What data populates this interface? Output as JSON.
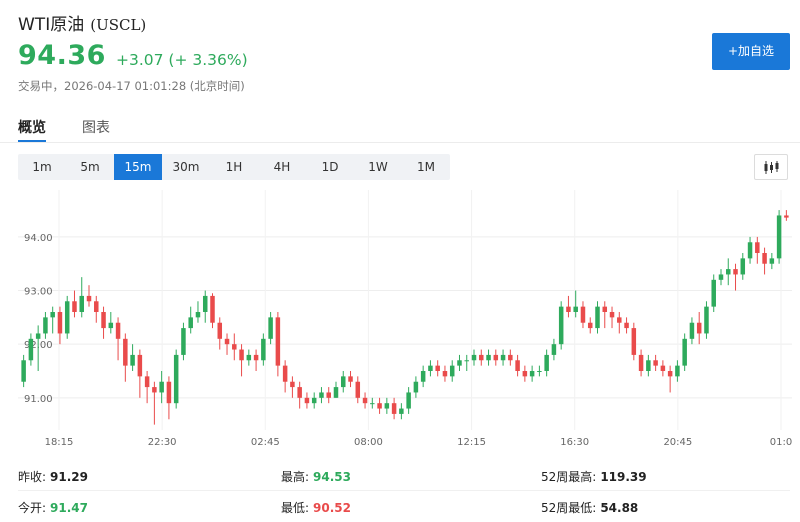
{
  "header": {
    "name": "WTI原油",
    "code": "(USCL)",
    "price": "94.36",
    "change": "+3.07 (+ 3.36%)",
    "status": "交易中，2026-04-17 01:01:28 (北京时间)",
    "add_button": "+加自选"
  },
  "tabs": [
    {
      "label": "概览",
      "active": true
    },
    {
      "label": "图表",
      "active": false
    }
  ],
  "intervals": [
    {
      "label": "1m"
    },
    {
      "label": "5m"
    },
    {
      "label": "15m",
      "active": true
    },
    {
      "label": "30m"
    },
    {
      "label": "1H"
    },
    {
      "label": "4H"
    },
    {
      "label": "1D"
    },
    {
      "label": "1W"
    },
    {
      "label": "1M"
    }
  ],
  "colors": {
    "up": "#2eaa5c",
    "down": "#e94b4b",
    "accent": "#1a78d8"
  },
  "icons": {
    "chart_type": "candlestick-chart-icon"
  },
  "chart_data": {
    "type": "candlestick",
    "y_ticks": [
      "91.00",
      "92.00",
      "93.00",
      "94.00"
    ],
    "x_ticks": [
      "18:15",
      "22:30",
      "02:45",
      "08:00",
      "12:15",
      "16:30",
      "20:45",
      "01:0"
    ],
    "ylim": [
      90.4,
      94.8
    ],
    "grid": true,
    "candles": [
      [
        91.3,
        91.7,
        91.2,
        91.8
      ],
      [
        91.7,
        92.1,
        91.6,
        92.2
      ],
      [
        92.1,
        92.2,
        91.5,
        92.35
      ],
      [
        92.2,
        92.5,
        92.1,
        92.6
      ],
      [
        92.5,
        92.6,
        92.2,
        92.7
      ],
      [
        92.6,
        92.2,
        92.0,
        92.7
      ],
      [
        92.2,
        92.8,
        92.1,
        92.9
      ],
      [
        92.8,
        92.6,
        92.5,
        93.0
      ],
      [
        92.6,
        92.9,
        92.5,
        93.25
      ],
      [
        92.9,
        92.8,
        92.7,
        93.1
      ],
      [
        92.8,
        92.6,
        92.4,
        92.9
      ],
      [
        92.6,
        92.3,
        92.1,
        92.7
      ],
      [
        92.3,
        92.4,
        92.2,
        92.6
      ],
      [
        92.4,
        92.1,
        91.7,
        92.5
      ],
      [
        92.1,
        91.6,
        91.3,
        92.2
      ],
      [
        91.6,
        91.8,
        91.5,
        92.0
      ],
      [
        91.8,
        91.4,
        91.0,
        91.9
      ],
      [
        91.4,
        91.2,
        90.9,
        91.5
      ],
      [
        91.2,
        91.1,
        90.5,
        91.3
      ],
      [
        91.1,
        91.3,
        90.9,
        91.5
      ],
      [
        91.3,
        90.9,
        90.6,
        91.4
      ],
      [
        90.9,
        91.8,
        90.8,
        91.9
      ],
      [
        91.8,
        92.3,
        91.7,
        92.4
      ],
      [
        92.3,
        92.5,
        92.2,
        92.7
      ],
      [
        92.5,
        92.6,
        92.4,
        92.8
      ],
      [
        92.6,
        92.9,
        92.4,
        93.0
      ],
      [
        92.9,
        92.4,
        92.3,
        92.95
      ],
      [
        92.4,
        92.1,
        91.9,
        92.5
      ],
      [
        92.1,
        92.0,
        91.8,
        92.2
      ],
      [
        92.0,
        91.9,
        91.7,
        92.2
      ],
      [
        91.9,
        91.7,
        91.4,
        92.0
      ],
      [
        91.7,
        91.8,
        91.6,
        91.9
      ],
      [
        91.8,
        91.7,
        91.5,
        91.9
      ],
      [
        91.7,
        92.1,
        91.6,
        92.2
      ],
      [
        92.1,
        92.5,
        92.0,
        92.6
      ],
      [
        92.5,
        91.6,
        91.4,
        92.6
      ],
      [
        91.6,
        91.3,
        91.1,
        91.7
      ],
      [
        91.3,
        91.2,
        91.0,
        91.4
      ],
      [
        91.2,
        91.0,
        90.8,
        91.3
      ],
      [
        91.0,
        90.9,
        90.8,
        91.1
      ],
      [
        90.9,
        91.0,
        90.8,
        91.1
      ],
      [
        91.0,
        91.1,
        90.9,
        91.2
      ],
      [
        91.1,
        91.0,
        90.9,
        91.2
      ],
      [
        91.0,
        91.2,
        91.0,
        91.3
      ],
      [
        91.2,
        91.4,
        91.1,
        91.5
      ],
      [
        91.4,
        91.3,
        91.2,
        91.5
      ],
      [
        91.3,
        91.0,
        90.9,
        91.4
      ],
      [
        91.0,
        90.9,
        90.8,
        91.1
      ],
      [
        90.9,
        90.9,
        90.8,
        91.0
      ],
      [
        90.9,
        90.8,
        90.7,
        91.0
      ],
      [
        90.8,
        90.9,
        90.7,
        91.0
      ],
      [
        90.9,
        90.7,
        90.6,
        91.0
      ],
      [
        90.7,
        90.8,
        90.6,
        90.9
      ],
      [
        90.8,
        91.1,
        90.7,
        91.2
      ],
      [
        91.1,
        91.3,
        91.0,
        91.4
      ],
      [
        91.3,
        91.5,
        91.2,
        91.6
      ],
      [
        91.5,
        91.6,
        91.4,
        91.7
      ],
      [
        91.6,
        91.5,
        91.4,
        91.7
      ],
      [
        91.5,
        91.4,
        91.3,
        91.6
      ],
      [
        91.4,
        91.6,
        91.3,
        91.7
      ],
      [
        91.6,
        91.7,
        91.5,
        91.8
      ],
      [
        91.7,
        91.7,
        91.5,
        91.8
      ],
      [
        91.7,
        91.8,
        91.6,
        91.9
      ],
      [
        91.8,
        91.7,
        91.6,
        91.9
      ],
      [
        91.7,
        91.8,
        91.6,
        91.9
      ],
      [
        91.8,
        91.7,
        91.6,
        91.9
      ],
      [
        91.7,
        91.8,
        91.6,
        91.9
      ],
      [
        91.8,
        91.7,
        91.6,
        91.9
      ],
      [
        91.7,
        91.5,
        91.4,
        91.8
      ],
      [
        91.5,
        91.4,
        91.3,
        91.6
      ],
      [
        91.4,
        91.5,
        91.3,
        91.6
      ],
      [
        91.5,
        91.5,
        91.4,
        91.6
      ],
      [
        91.5,
        91.8,
        91.4,
        91.9
      ],
      [
        91.8,
        92.0,
        91.7,
        92.1
      ],
      [
        92.0,
        92.7,
        91.9,
        92.8
      ],
      [
        92.7,
        92.6,
        92.5,
        92.9
      ],
      [
        92.6,
        92.7,
        92.5,
        93.0
      ],
      [
        92.7,
        92.4,
        92.3,
        92.8
      ],
      [
        92.4,
        92.3,
        92.2,
        92.5
      ],
      [
        92.3,
        92.7,
        92.2,
        92.8
      ],
      [
        92.7,
        92.6,
        92.3,
        92.8
      ],
      [
        92.6,
        92.5,
        92.3,
        92.7
      ],
      [
        92.5,
        92.4,
        92.2,
        92.6
      ],
      [
        92.4,
        92.3,
        92.2,
        92.5
      ],
      [
        92.3,
        91.8,
        91.7,
        92.4
      ],
      [
        91.8,
        91.5,
        91.4,
        91.9
      ],
      [
        91.5,
        91.7,
        91.4,
        91.8
      ],
      [
        91.7,
        91.6,
        91.5,
        91.8
      ],
      [
        91.6,
        91.5,
        91.4,
        91.7
      ],
      [
        91.5,
        91.4,
        91.1,
        91.6
      ],
      [
        91.4,
        91.6,
        91.3,
        91.7
      ],
      [
        91.6,
        92.1,
        91.5,
        92.2
      ],
      [
        92.1,
        92.4,
        92.0,
        92.5
      ],
      [
        92.4,
        92.2,
        92.0,
        92.6
      ],
      [
        92.2,
        92.7,
        92.1,
        92.8
      ],
      [
        92.7,
        93.2,
        92.6,
        93.3
      ],
      [
        93.2,
        93.3,
        93.1,
        93.4
      ],
      [
        93.3,
        93.4,
        93.1,
        93.6
      ],
      [
        93.4,
        93.3,
        93.0,
        93.5
      ],
      [
        93.3,
        93.6,
        93.2,
        93.7
      ],
      [
        93.6,
        93.9,
        93.5,
        94.0
      ],
      [
        93.9,
        93.7,
        93.5,
        94.0
      ],
      [
        93.7,
        93.5,
        93.3,
        93.8
      ],
      [
        93.5,
        93.6,
        93.4,
        93.7
      ],
      [
        93.6,
        94.4,
        93.5,
        94.5
      ],
      [
        94.4,
        94.36,
        94.3,
        94.5
      ]
    ]
  },
  "stats": [
    {
      "label": "昨收:",
      "value": "91.29",
      "tone": "plain"
    },
    {
      "label": "最高:",
      "value": "94.53",
      "tone": "green"
    },
    {
      "label": "52周最高:",
      "value": "119.39",
      "tone": "plain"
    },
    {
      "label": "今开:",
      "value": "91.47",
      "tone": "green"
    },
    {
      "label": "最低:",
      "value": "90.52",
      "tone": "red"
    },
    {
      "label": "52周最低:",
      "value": "54.88",
      "tone": "plain"
    }
  ]
}
